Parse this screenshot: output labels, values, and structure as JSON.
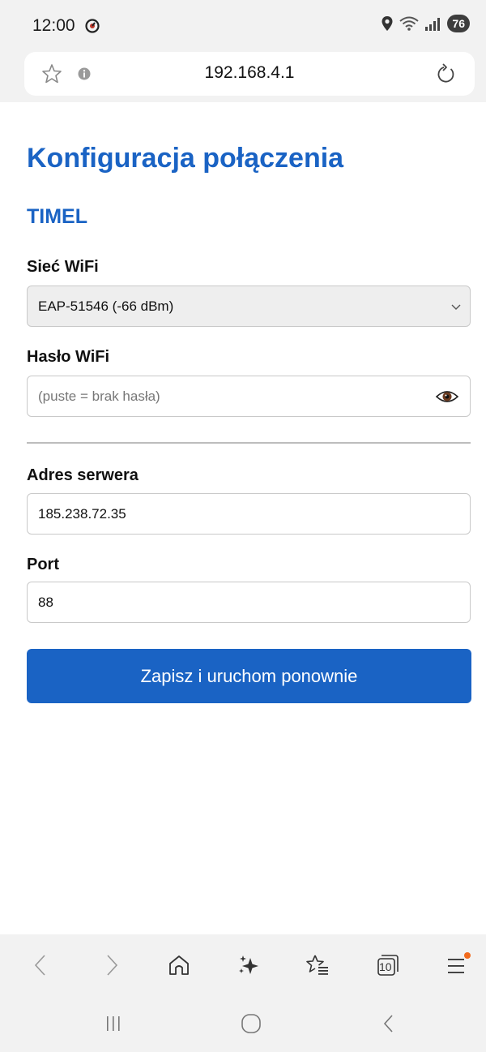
{
  "status_bar": {
    "time": "12:00",
    "battery": "76"
  },
  "browser": {
    "url": "192.168.4.1"
  },
  "page": {
    "title": "Konfiguracja połączenia",
    "device_name": "TIMEL",
    "wifi_network": {
      "label": "Sieć WiFi",
      "selected": "EAP-51546 (-66 dBm)"
    },
    "wifi_password": {
      "label": "Hasło WiFi",
      "value": "",
      "placeholder": "(puste = brak hasła)"
    },
    "server_address": {
      "label": "Adres serwera",
      "value": "185.238.72.35"
    },
    "port": {
      "label": "Port",
      "value": "88"
    },
    "save_button_label": "Zapisz i uruchom ponownie"
  },
  "toolbar": {
    "tabs_count": "10",
    "menu_notification_color": "#f26b1d"
  },
  "colors": {
    "accent": "#1a63c4",
    "chrome_background": "#f2f2f2"
  },
  "icons": [
    "alarm-icon",
    "location-icon",
    "wifi-icon",
    "signal-icon",
    "star-icon",
    "info-icon",
    "reload-icon",
    "chevron-down-icon",
    "eye-icon",
    "back-icon",
    "forward-icon",
    "home-icon",
    "sparkle-icon",
    "bookmarks-icon",
    "tabs-icon",
    "menu-icon",
    "recent-apps-icon",
    "home-nav-icon",
    "back-nav-icon"
  ]
}
